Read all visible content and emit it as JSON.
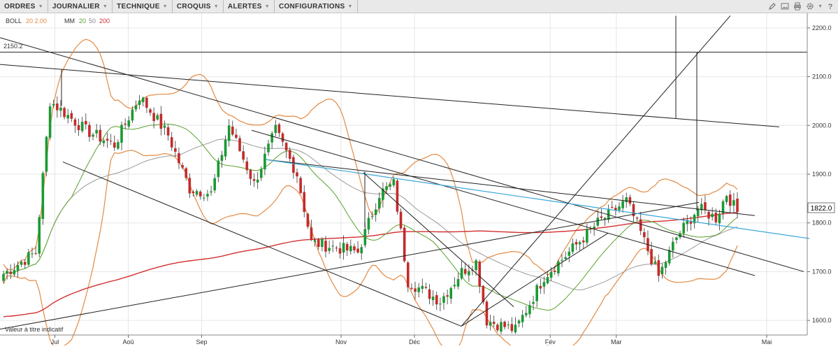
{
  "menu": [
    {
      "label": "ORDRES"
    },
    {
      "label": "JOURNALIER"
    },
    {
      "label": "TECHNIQUE"
    },
    {
      "label": "CROQUIS"
    },
    {
      "label": "ALERTES"
    },
    {
      "label": "CONFIGURATIONS"
    }
  ],
  "toolbar_icons": [
    "pencil-icon",
    "image-icon",
    "print-icon",
    "gear-icon",
    "help-icon"
  ],
  "legend": {
    "boll_name": "BOLL",
    "boll_params": "20 2.00",
    "mm_name": "MM",
    "mm_p1": "20",
    "mm_p2": "50",
    "mm_p3": "200"
  },
  "colors": {
    "up": "#1a9a33",
    "down": "#c42a2a",
    "boll": "#e38a42",
    "mm20": "#5aa02c",
    "mm50": "#9a9a9a",
    "mm200": "#d23030",
    "trend": "#222222",
    "blue": "#3aa7d8"
  },
  "disclaimer": "Valeur à titre indicatif",
  "chart_data": {
    "type": "candlestick",
    "y_axis": {
      "ticks": [
        "2200.0",
        "2100.0",
        "2000.0",
        "1900.0",
        "1800.0",
        "1700.0",
        "1600.0"
      ],
      "min": 1570,
      "max": 2230
    },
    "x_axis": {
      "ticks": [
        "Jul",
        "Aoû",
        "Sep",
        "Nov",
        "Déc",
        "Fév",
        "Mar",
        "Mai"
      ]
    },
    "last_price": "1822.0",
    "level_label": "2150.2",
    "grid": true,
    "segments": [
      {
        "trend": "up",
        "start": 1690,
        "end": 1740,
        "n": 10
      },
      {
        "trend": "up",
        "start": 1740,
        "end": 2050,
        "n": 4
      },
      {
        "trend": "down",
        "start": 2050,
        "end": 1990,
        "n": 10
      },
      {
        "trend": "down",
        "start": 1990,
        "end": 1960,
        "n": 8
      },
      {
        "trend": "up",
        "start": 1960,
        "end": 2060,
        "n": 7
      },
      {
        "trend": "down",
        "start": 2060,
        "end": 1980,
        "n": 8
      },
      {
        "trend": "down",
        "start": 1980,
        "end": 1870,
        "n": 6
      },
      {
        "trend": "down",
        "start": 1870,
        "end": 1860,
        "n": 6
      },
      {
        "trend": "up",
        "start": 1860,
        "end": 2000,
        "n": 5
      },
      {
        "trend": "down",
        "start": 2000,
        "end": 1880,
        "n": 7
      },
      {
        "trend": "up",
        "start": 1880,
        "end": 1990,
        "n": 6
      },
      {
        "trend": "down",
        "start": 1990,
        "end": 1900,
        "n": 6
      },
      {
        "trend": "down",
        "start": 1900,
        "end": 1760,
        "n": 4
      },
      {
        "trend": "down",
        "start": 1760,
        "end": 1740,
        "n": 13
      },
      {
        "trend": "up",
        "start": 1740,
        "end": 1860,
        "n": 6
      },
      {
        "trend": "up",
        "start": 1860,
        "end": 1880,
        "n": 4
      },
      {
        "trend": "down",
        "start": 1880,
        "end": 1680,
        "n": 4
      },
      {
        "trend": "down",
        "start": 1680,
        "end": 1640,
        "n": 9
      },
      {
        "trend": "up",
        "start": 1640,
        "end": 1700,
        "n": 6
      },
      {
        "trend": "up",
        "start": 1700,
        "end": 1720,
        "n": 4
      },
      {
        "trend": "down",
        "start": 1720,
        "end": 1600,
        "n": 3
      },
      {
        "trend": "down",
        "start": 1600,
        "end": 1580,
        "n": 8
      },
      {
        "trend": "up",
        "start": 1580,
        "end": 1690,
        "n": 8
      },
      {
        "trend": "up",
        "start": 1690,
        "end": 1740,
        "n": 7
      },
      {
        "trend": "up",
        "start": 1740,
        "end": 1800,
        "n": 8
      },
      {
        "trend": "up",
        "start": 1800,
        "end": 1845,
        "n": 8
      },
      {
        "trend": "down",
        "start": 1845,
        "end": 1780,
        "n": 4
      },
      {
        "trend": "down",
        "start": 1780,
        "end": 1690,
        "n": 5
      },
      {
        "trend": "up",
        "start": 1690,
        "end": 1770,
        "n": 5
      },
      {
        "trend": "up",
        "start": 1770,
        "end": 1830,
        "n": 6
      },
      {
        "trend": "up",
        "start": 1830,
        "end": 1810,
        "n": 5
      },
      {
        "trend": "up",
        "start": 1810,
        "end": 1860,
        "n": 3
      },
      {
        "trend": "down",
        "start": 1860,
        "end": 1822,
        "n": 3
      }
    ]
  }
}
